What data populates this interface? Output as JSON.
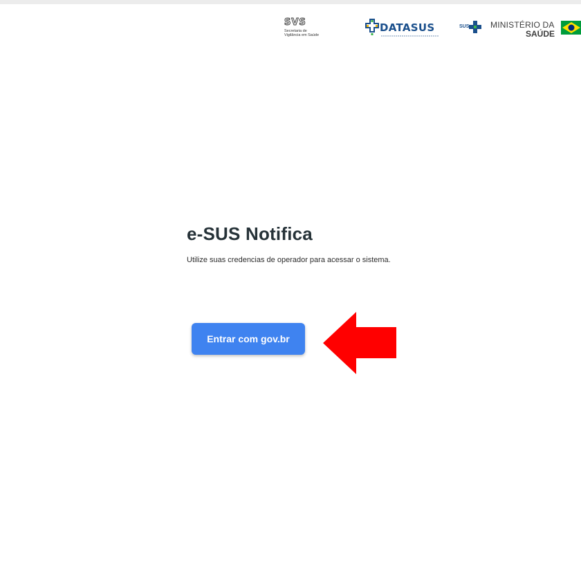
{
  "header": {
    "svs_logo": {
      "mark": "SVS",
      "line1": "Secretaria de",
      "line2": "Vigilância em Saúde"
    },
    "datasus_logo": {
      "name": "DATASUS"
    },
    "ministry_logo": {
      "sus": "SUS",
      "line1": "MINISTÉRIO DA",
      "line2": "SAÚDE"
    }
  },
  "main": {
    "title": "e-SUS Notifica",
    "subtitle": "Utilize suas credencias de operador para acessar o sistema.",
    "login_button": "Entrar com gov.br"
  },
  "annotation": {
    "icon": "arrow-left-icon",
    "color": "#ff0000"
  },
  "colors": {
    "button": "#3f83f0",
    "title": "#263238",
    "datasus": "#1a4f8c"
  }
}
